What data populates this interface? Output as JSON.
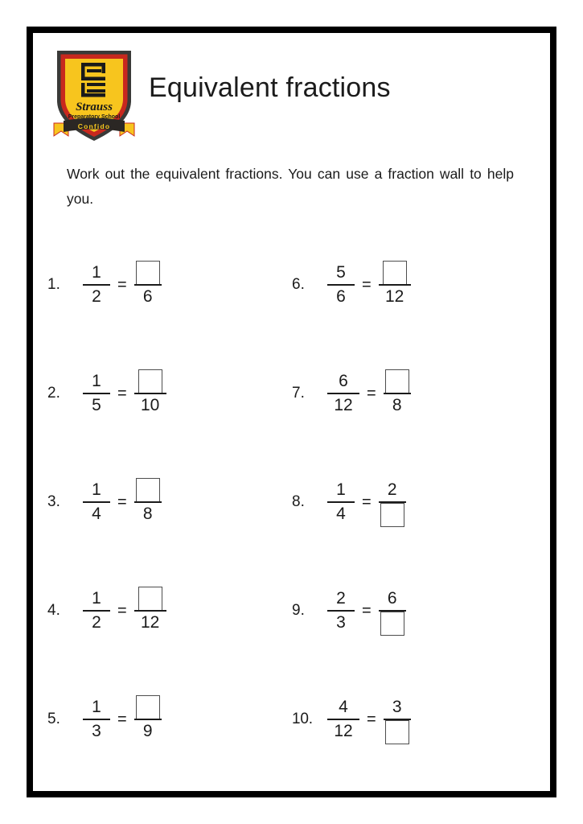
{
  "page": {
    "title": "Equivalent fractions",
    "instructions": "Work out the equivalent fractions. You can use a fraction wall to help you.",
    "border_color": "#000000",
    "background": "#ffffff",
    "text_color": "#1b1b1b"
  },
  "logo": {
    "name": "strauss-preparatory-school-crest",
    "school_name": "Strauss",
    "school_subtitle": "Preparatory School",
    "motto": "Confido",
    "shield_fill": "#F7C51E",
    "shield_outline": "#C8281E",
    "shield_edge": "#3A3A38",
    "banner_fill": "#2B2724",
    "ribbon_fill": "#F7C51E",
    "monogram_color": "#1A1A1A"
  },
  "questions": [
    {
      "number": "1.",
      "left": {
        "numerator": "1",
        "denominator": "2",
        "blank": "none"
      },
      "operator": "=",
      "right": {
        "numerator": "",
        "denominator": "6",
        "blank": "numerator"
      }
    },
    {
      "number": "2.",
      "left": {
        "numerator": "1",
        "denominator": "5",
        "blank": "none"
      },
      "operator": "=",
      "right": {
        "numerator": "",
        "denominator": "10",
        "blank": "numerator"
      }
    },
    {
      "number": "3.",
      "left": {
        "numerator": "1",
        "denominator": "4",
        "blank": "none"
      },
      "operator": "=",
      "right": {
        "numerator": "",
        "denominator": "8",
        "blank": "numerator"
      }
    },
    {
      "number": "4.",
      "left": {
        "numerator": "1",
        "denominator": "2",
        "blank": "none"
      },
      "operator": "=",
      "right": {
        "numerator": "",
        "denominator": "12",
        "blank": "numerator"
      }
    },
    {
      "number": "5.",
      "left": {
        "numerator": "1",
        "denominator": "3",
        "blank": "none"
      },
      "operator": "=",
      "right": {
        "numerator": "",
        "denominator": "9",
        "blank": "numerator"
      }
    },
    {
      "number": "6.",
      "left": {
        "numerator": "5",
        "denominator": "6",
        "blank": "none"
      },
      "operator": "=",
      "right": {
        "numerator": "",
        "denominator": "12",
        "blank": "numerator"
      }
    },
    {
      "number": "7.",
      "left": {
        "numerator": "6",
        "denominator": "12",
        "blank": "none"
      },
      "operator": "=",
      "right": {
        "numerator": "",
        "denominator": "8",
        "blank": "numerator"
      }
    },
    {
      "number": "8.",
      "left": {
        "numerator": "1",
        "denominator": "4",
        "blank": "none"
      },
      "operator": "=",
      "right": {
        "numerator": "2",
        "denominator": "",
        "blank": "denominator"
      }
    },
    {
      "number": "9.",
      "left": {
        "numerator": "2",
        "denominator": "3",
        "blank": "none"
      },
      "operator": "=",
      "right": {
        "numerator": "6",
        "denominator": "",
        "blank": "denominator"
      }
    },
    {
      "number": "10.",
      "left": {
        "numerator": "4",
        "denominator": "12",
        "blank": "none"
      },
      "operator": "=",
      "right": {
        "numerator": "3",
        "denominator": "",
        "blank": "denominator"
      }
    }
  ]
}
